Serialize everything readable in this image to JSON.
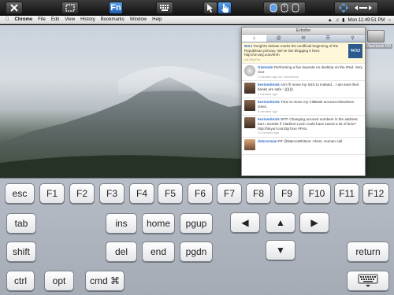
{
  "menubar": {
    "app": "Chrome",
    "items": [
      "File",
      "Edit",
      "View",
      "History",
      "Bookmarks",
      "Window",
      "Help"
    ],
    "clock": "Mon 11:49:51 PM"
  },
  "desktop": {
    "drive_label": "Macintosh HD"
  },
  "twitter_window": {
    "title": "Echofon",
    "tweets": [
      {
        "author": "WSJ",
        "text": "Tonight's debate marks the unofficial beginning of the Republican primary. We've live blogging it here: http://on.wsj.com/emh",
        "time": "via Wsj Pro"
      },
      {
        "author": "Gizmodo",
        "text": "Performing a live keynote on desktop on the iPad. Very nice",
        "time": "2 minutes ago via TweetDeck"
      },
      {
        "author": "kevinmitnick",
        "text": "Ach I'll move my SSS to Iceland... I am sure their banks are safe :-)))))))",
        "time": "4 minutes ago"
      },
      {
        "author": "kevinmitnick",
        "text": "Time to move my CitiBank account elsewhere. Geez.",
        "time": "6 minutes ago"
      },
      {
        "author": "kevinmitnick",
        "text": "WTF Changing account numbers in the address bar! I wonder if Vladimir Levin could have saved a lot of time? http://tinyurl.com/3p7oxx #FAIL",
        "time": "11 minutes ago"
      },
      {
        "author": "dvbcorman",
        "text": "RT @MarcoWhitson: Ahem. Human call",
        "time": ""
      }
    ]
  },
  "keyboard": {
    "function_row": [
      "esc",
      "F1",
      "F2",
      "F3",
      "F4",
      "F5",
      "F6",
      "F7",
      "F8",
      "F9",
      "F10",
      "F11",
      "F12"
    ],
    "tab": "tab",
    "ins": "ins",
    "home": "home",
    "pgup": "pgup",
    "shift": "shift",
    "del": "del",
    "end": "end",
    "pgdn": "pgdn",
    "return": "return",
    "ctrl": "ctrl",
    "opt": "opt",
    "cmd": "cmd ⌘",
    "arrows": {
      "left": "◀",
      "up": "▲",
      "right": "▶",
      "down": "▼"
    }
  },
  "icons": [
    "close-x-icon",
    "window-resize-icon",
    "fn-icon",
    "keyboard-grid-icon",
    "pointer-icon",
    "hand-pointer-icon",
    "mouse-icon",
    "scroll-arrows-icon",
    "hide-keyboard-icon"
  ]
}
